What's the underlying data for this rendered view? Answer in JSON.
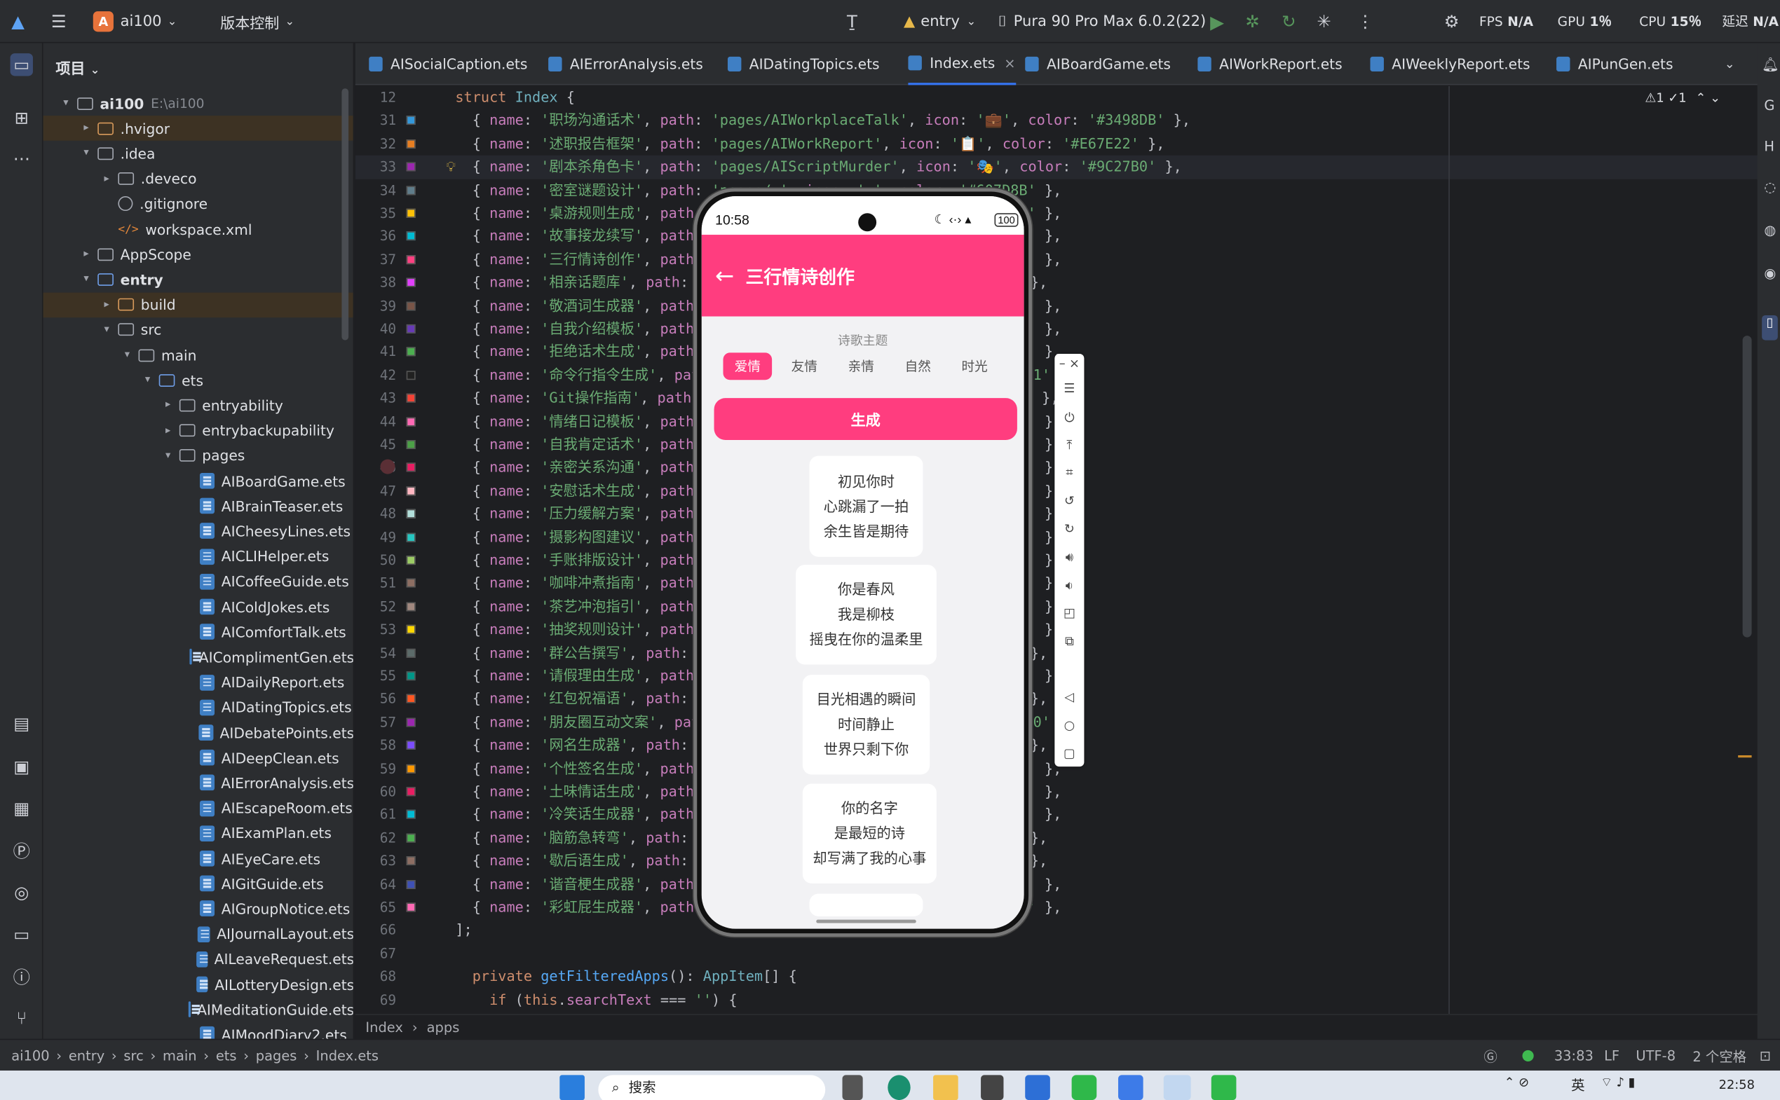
{
  "titlebar": {
    "project": "ai100",
    "project_badge": "A",
    "vcs": "版本控制",
    "run_config": "entry",
    "device": "Pura 90 Pro Max 6.0.2(22)",
    "fps": "FPS",
    "fps_val": "N/A",
    "gpu": "GPU",
    "gpu_val": "1％",
    "cpu": "CPU",
    "cpu_val": "15％",
    "latency": "延迟",
    "latency_val": "N/A"
  },
  "project_panel": {
    "title": "项目",
    "items": [
      {
        "label": "ai100",
        "extra": "E:\\ai100",
        "depth": 0,
        "arrow": "▾",
        "kind": "folder",
        "bold": true
      },
      {
        "label": ".hvigor",
        "depth": 1,
        "arrow": "▸",
        "kind": "folder-orange",
        "hl": true
      },
      {
        "label": ".idea",
        "depth": 1,
        "arrow": "▾",
        "kind": "folder"
      },
      {
        "label": ".deveco",
        "depth": 2,
        "arrow": "▸",
        "kind": "folder"
      },
      {
        "label": ".gitignore",
        "depth": 2,
        "arrow": "",
        "kind": "git"
      },
      {
        "label": "workspace.xml",
        "depth": 2,
        "arrow": "",
        "kind": "xml"
      },
      {
        "label": "AppScope",
        "depth": 1,
        "arrow": "▸",
        "kind": "folder"
      },
      {
        "label": "entry",
        "depth": 1,
        "arrow": "▾",
        "kind": "folder-blue",
        "bold": true
      },
      {
        "label": "build",
        "depth": 2,
        "arrow": "▸",
        "kind": "folder-orange",
        "hl": true
      },
      {
        "label": "src",
        "depth": 2,
        "arrow": "▾",
        "kind": "folder"
      },
      {
        "label": "main",
        "depth": 3,
        "arrow": "▾",
        "kind": "folder"
      },
      {
        "label": "ets",
        "depth": 4,
        "arrow": "▾",
        "kind": "folder-blue"
      },
      {
        "label": "entryability",
        "depth": 5,
        "arrow": "▸",
        "kind": "folder"
      },
      {
        "label": "entrybackupability",
        "depth": 5,
        "arrow": "▸",
        "kind": "folder"
      },
      {
        "label": "pages",
        "depth": 5,
        "arrow": "▾",
        "kind": "folder"
      },
      {
        "label": "AIBoardGame.ets",
        "depth": 6,
        "arrow": "",
        "kind": "file"
      },
      {
        "label": "AIBrainTeaser.ets",
        "depth": 6,
        "arrow": "",
        "kind": "file"
      },
      {
        "label": "AICheesyLines.ets",
        "depth": 6,
        "arrow": "",
        "kind": "file"
      },
      {
        "label": "AICLIHelper.ets",
        "depth": 6,
        "arrow": "",
        "kind": "file"
      },
      {
        "label": "AICoffeeGuide.ets",
        "depth": 6,
        "arrow": "",
        "kind": "file"
      },
      {
        "label": "AIColdJokes.ets",
        "depth": 6,
        "arrow": "",
        "kind": "file"
      },
      {
        "label": "AIComfortTalk.ets",
        "depth": 6,
        "arrow": "",
        "kind": "file"
      },
      {
        "label": "AIComplimentGen.ets",
        "depth": 6,
        "arrow": "",
        "kind": "file"
      },
      {
        "label": "AIDailyReport.ets",
        "depth": 6,
        "arrow": "",
        "kind": "file"
      },
      {
        "label": "AIDatingTopics.ets",
        "depth": 6,
        "arrow": "",
        "kind": "file"
      },
      {
        "label": "AIDebatePoints.ets",
        "depth": 6,
        "arrow": "",
        "kind": "file"
      },
      {
        "label": "AIDeepClean.ets",
        "depth": 6,
        "arrow": "",
        "kind": "file"
      },
      {
        "label": "AIErrorAnalysis.ets",
        "depth": 6,
        "arrow": "",
        "kind": "file"
      },
      {
        "label": "AIEscapeRoom.ets",
        "depth": 6,
        "arrow": "",
        "kind": "file"
      },
      {
        "label": "AIExamPlan.ets",
        "depth": 6,
        "arrow": "",
        "kind": "file"
      },
      {
        "label": "AIEyeCare.ets",
        "depth": 6,
        "arrow": "",
        "kind": "file"
      },
      {
        "label": "AIGitGuide.ets",
        "depth": 6,
        "arrow": "",
        "kind": "file"
      },
      {
        "label": "AIGroupNotice.ets",
        "depth": 6,
        "arrow": "",
        "kind": "file"
      },
      {
        "label": "AIJournalLayout.ets",
        "depth": 6,
        "arrow": "",
        "kind": "file"
      },
      {
        "label": "AILeaveRequest.ets",
        "depth": 6,
        "arrow": "",
        "kind": "file"
      },
      {
        "label": "AILotteryDesign.ets",
        "depth": 6,
        "arrow": "",
        "kind": "file"
      },
      {
        "label": "AIMeditationGuide.ets",
        "depth": 6,
        "arrow": "",
        "kind": "file"
      },
      {
        "label": "AIMoodDiary2.ets",
        "depth": 6,
        "arrow": "",
        "kind": "file"
      }
    ]
  },
  "tabs": [
    {
      "label": "AISocialCaption.ets",
      "active": false
    },
    {
      "label": "AIErrorAnalysis.ets",
      "active": false
    },
    {
      "label": "AIDatingTopics.ets",
      "active": false
    },
    {
      "label": "Index.ets",
      "active": true
    },
    {
      "label": "AIBoardGame.ets",
      "active": false
    },
    {
      "label": "AIWorkReport.ets",
      "active": false
    },
    {
      "label": "AIWeeklyReport.ets",
      "active": false
    },
    {
      "label": "AIPunGen.ets",
      "active": false
    }
  ],
  "editor": {
    "hint": "⚠1 ✓1",
    "header_line": {
      "num": "12",
      "code": "struct Index {"
    },
    "lines": [
      {
        "n": "31",
        "name": "职场沟通话术",
        "path": "pages/AIWorkplaceTalk",
        "icon": "💼",
        "color": "#3498DB",
        "sw": "#3498DB"
      },
      {
        "n": "32",
        "name": "述职报告框架",
        "path": "pages/AIWorkReport",
        "icon": "📋",
        "color": "#E67E22",
        "sw": "#E67E22"
      },
      {
        "n": "33",
        "name": "剧本杀角色卡",
        "path": "pages/AIScriptMurder",
        "icon": "🎭",
        "color": "#9C27B0",
        "sw": "#9C27B0",
        "cur": true
      },
      {
        "n": "34",
        "name": "密室谜题设计",
        "path": "",
        "color": "#607D8B",
        "sw": "#607D8B"
      },
      {
        "n": "35",
        "name": "桌游规则生成",
        "path": "",
        "color": "#FFC107",
        "sw": "#FFC107"
      },
      {
        "n": "36",
        "name": "故事接龙续写",
        "path": "",
        "color": "#00BCD4",
        "sw": "#00BCD4"
      },
      {
        "n": "37",
        "name": "三行情诗创作",
        "path": "",
        "color": "#FF4081",
        "sw": "#FF4081"
      },
      {
        "n": "38",
        "name": "相亲话题库",
        "path": "",
        "color": "#E040FB",
        "sw": "#E040FB"
      },
      {
        "n": "39",
        "name": "敬酒词生成器",
        "path": "",
        "color": "#795548",
        "sw": "#795548"
      },
      {
        "n": "40",
        "name": "自我介绍模板",
        "path": "",
        "color": "#673AB7",
        "sw": "#673AB7"
      },
      {
        "n": "41",
        "name": "拒绝话术生成",
        "path": "",
        "color": "#4CAF50",
        "sw": "#4CAF50"
      },
      {
        "n": "42",
        "name": "命令行指令生成",
        "path": "",
        "color": "#212121",
        "sw": "#212121"
      },
      {
        "n": "43",
        "name": "Git操作指南",
        "path": "",
        "color": "#F44336",
        "sw": "#F44336"
      },
      {
        "n": "44",
        "name": "情绪日记模板",
        "path": "",
        "color": "#FF69B4",
        "sw": "#FF69B4"
      },
      {
        "n": "45",
        "name": "自我肯定话术",
        "path": "",
        "color": "#4CA047",
        "sw": "#4CA047"
      },
      {
        "n": "46",
        "name": "亲密关系沟通",
        "path": "",
        "color": "#E91E63",
        "sw": "#E91E63"
      },
      {
        "n": "47",
        "name": "安慰话术生成",
        "path": "",
        "color": "#FFB6C1",
        "sw": "#FFB6C1"
      },
      {
        "n": "48",
        "name": "压力缓解方案",
        "path": "",
        "color": "#B2DFDB",
        "sw": "#B2DFDB"
      },
      {
        "n": "49",
        "name": "摄影构图建议",
        "path": "",
        "color": "#26C6C1",
        "sw": "#26C6C1"
      },
      {
        "n": "50",
        "name": "手账排版设计",
        "path": "",
        "color": "#9CCC65",
        "sw": "#9CCC65"
      },
      {
        "n": "51",
        "name": "咖啡冲煮指南",
        "path": "",
        "color": "#8D6E63",
        "sw": "#8D6E63"
      },
      {
        "n": "52",
        "name": "茶艺冲泡指引",
        "path": "",
        "color": "#A1887F",
        "sw": "#A1887F"
      },
      {
        "n": "53",
        "name": "抽奖规则设计",
        "path": "",
        "color": "#FFD700",
        "sw": "#FFD700"
      },
      {
        "n": "54",
        "name": "群公告撰写",
        "path": "",
        "color": "#5C6B6A",
        "sw": "#5C6B6A"
      },
      {
        "n": "55",
        "name": "请假理由生成",
        "path": "",
        "color": "#009688",
        "sw": "#009688"
      },
      {
        "n": "56",
        "name": "红包祝福语",
        "path": "",
        "color": "#FF5722",
        "sw": "#FF5722"
      },
      {
        "n": "57",
        "name": "朋友圈互动文案",
        "path": "",
        "color": "#9C27B0",
        "sw": "#9C27B0"
      },
      {
        "n": "58",
        "name": "网名生成器",
        "path": "",
        "color": "#7C4DFF",
        "sw": "#7C4DFF"
      },
      {
        "n": "59",
        "name": "个性签名生成",
        "path": "",
        "color": "#FF9800",
        "sw": "#FF9800"
      },
      {
        "n": "60",
        "name": "土味情话生成",
        "path": "",
        "color": "#E91E63",
        "sw": "#E91E63"
      },
      {
        "n": "61",
        "name": "冷笑话生成器",
        "path": "",
        "color": "#00BCD4",
        "sw": "#00BCD4"
      },
      {
        "n": "62",
        "name": "脑筋急转弯",
        "path": "",
        "color": "#4CAF50",
        "sw": "#4CAF50"
      },
      {
        "n": "63",
        "name": "歇后语生成",
        "path": "",
        "color": "#8D6E63",
        "sw": "#8D6E63"
      },
      {
        "n": "64",
        "name": "谐音梗生成器",
        "path": "",
        "color": "#3F51B5",
        "sw": "#3F51B5"
      },
      {
        "n": "65",
        "name": "彩虹屁生成器",
        "path": "",
        "color": "#FF69B4",
        "sw": "#FF69B4"
      }
    ],
    "tail": [
      {
        "n": "66",
        "code": "];"
      },
      {
        "n": "67",
        "code": ""
      },
      {
        "n": "68",
        "code": "private getFilteredApps(): AppItem[] {"
      },
      {
        "n": "69",
        "code": "if (this.searchText === '') {"
      }
    ]
  },
  "breadcrumb": {
    "a": "Index",
    "b": "apps"
  },
  "statusbar": {
    "path": [
      "ai100",
      "entry",
      "src",
      "main",
      "ets",
      "pages",
      "Index.ets"
    ],
    "position": "33:83",
    "eol": "LF",
    "encoding": "UTF-8",
    "indent": "2 个空格"
  },
  "phone": {
    "time": "10:58",
    "battery": "100",
    "title": "三行情诗创作",
    "back": "←",
    "theme_label": "诗歌主题",
    "chips": [
      {
        "label": "爱情",
        "on": true
      },
      {
        "label": "友情",
        "on": false
      },
      {
        "label": "亲情",
        "on": false
      },
      {
        "label": "自然",
        "on": false
      },
      {
        "label": "时光",
        "on": false
      }
    ],
    "generate": "生成",
    "poems": [
      [
        "初见你时",
        "心跳漏了一拍",
        "余生皆是期待"
      ],
      [
        "你是春风",
        "我是柳枝",
        "摇曳在你的温柔里"
      ],
      [
        "目光相遇的瞬间",
        "时间静止",
        "世界只剩下你"
      ],
      [
        "你的名字",
        "是最短的诗",
        "却写满了我的心事"
      ]
    ]
  },
  "taskbar": {
    "search": "搜索",
    "time": "22:58",
    "ime": "英"
  }
}
